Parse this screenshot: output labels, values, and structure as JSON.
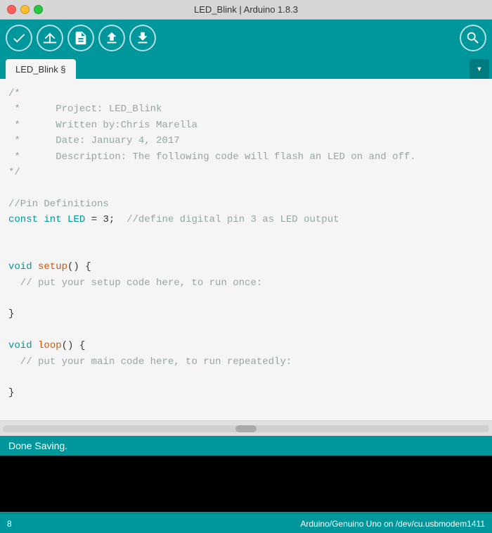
{
  "window": {
    "title": "LED_Blink | Arduino 1.8.3"
  },
  "toolbar": {
    "buttons": [
      "verify",
      "upload",
      "new",
      "open",
      "save"
    ],
    "search_label": "search"
  },
  "tabs": {
    "active_tab": "LED_Blink §",
    "dropdown_label": "▾"
  },
  "code": {
    "lines": [
      {
        "type": "comment",
        "text": "/*"
      },
      {
        "type": "comment",
        "text": " *      Project: LED_Blink"
      },
      {
        "type": "comment",
        "text": " *      Written by:Chris Marella"
      },
      {
        "type": "comment",
        "text": " *      Date: January 4, 2017"
      },
      {
        "type": "comment",
        "text": " *      Description: The following code will flash an LED on and off."
      },
      {
        "type": "comment",
        "text": "*/"
      },
      {
        "type": "blank",
        "text": ""
      },
      {
        "type": "comment",
        "text": "//Pin Definitions"
      },
      {
        "type": "code",
        "text": "const int LED = 3;  //define digital pin 3 as LED output"
      },
      {
        "type": "blank",
        "text": ""
      },
      {
        "type": "blank",
        "text": ""
      },
      {
        "type": "code",
        "text": "void setup() {"
      },
      {
        "type": "code",
        "text": "  // put your setup code here, to run once:"
      },
      {
        "type": "blank",
        "text": ""
      },
      {
        "type": "code",
        "text": "}"
      },
      {
        "type": "blank",
        "text": ""
      },
      {
        "type": "code",
        "text": "void loop() {"
      },
      {
        "type": "code",
        "text": "  // put your main code here, to run repeatedly:"
      },
      {
        "type": "blank",
        "text": ""
      },
      {
        "type": "code",
        "text": "}"
      }
    ]
  },
  "status": {
    "message": "Done Saving.",
    "board": "Arduino/Genuino Uno on /dev/cu.usbmodem1411",
    "line_number": "8"
  }
}
